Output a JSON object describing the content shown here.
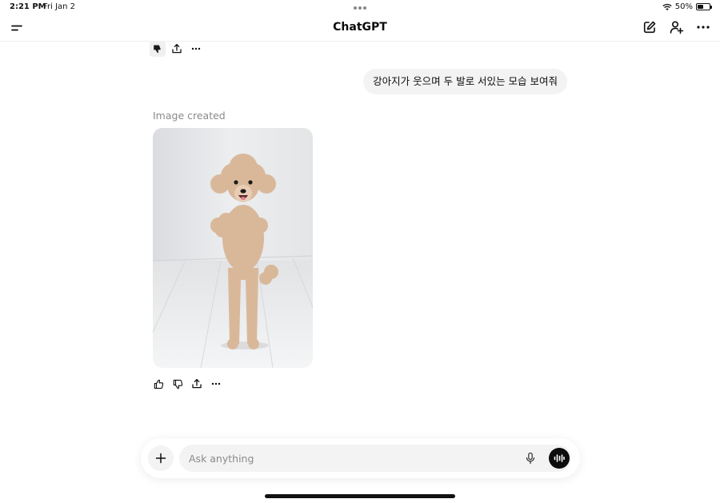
{
  "status_bar": {
    "time": "2:21 PM",
    "date": "Fri Jan 2",
    "battery_text": "50%",
    "battery_level": 0.5
  },
  "header": {
    "title": "ChatGPT"
  },
  "conversation": {
    "user_message": "강아지가 웃으며 두 발로 서있는 모습 보여줘",
    "image_label": "Image created"
  },
  "composer": {
    "placeholder": "Ask anything"
  },
  "icons": [
    "sidebar-toggle-icon",
    "new-chat-icon",
    "add-people-icon",
    "more-icon",
    "thumbs-up-icon",
    "thumbs-down-icon",
    "share-icon",
    "plus-icon",
    "microphone-icon",
    "voice-mode-icon"
  ]
}
